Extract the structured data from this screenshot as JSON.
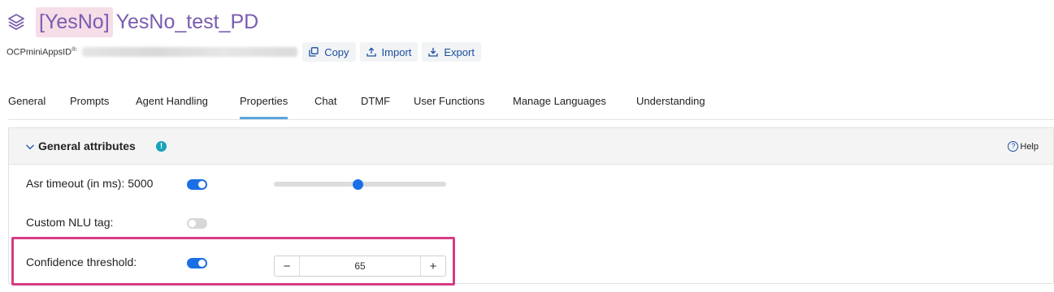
{
  "header": {
    "tag": "[YesNo]",
    "title": "YesNo_test_PD",
    "id_label": "OCPminiAppsID",
    "id_label_sup": "®:",
    "buttons": {
      "copy": "Copy",
      "import": "Import",
      "export": "Export"
    }
  },
  "icons": {
    "title": "layers-icon",
    "copy": "copy-icon",
    "import": "upload-icon",
    "export": "download-icon",
    "collapse": "chevron-down-icon",
    "info": "info-icon",
    "help": "question-circle-icon"
  },
  "tabs": [
    "General",
    "Prompts",
    "Agent Handling",
    "Properties",
    "Chat",
    "DTMF",
    "User Functions",
    "Manage Languages",
    "Understanding"
  ],
  "active_tab": "Properties",
  "panel": {
    "title": "General attributes",
    "info_glyph": "!",
    "help_glyph": "?",
    "help_label": "Help",
    "rows": {
      "asr": {
        "label": "Asr timeout (in ms): 5000",
        "enabled": true,
        "slider_fraction": 0.49
      },
      "nlu": {
        "label": "Custom NLU tag:",
        "enabled": false
      },
      "confidence": {
        "label": "Confidence threshold:",
        "enabled": true,
        "value": "65",
        "minus": "−",
        "plus": "+"
      }
    }
  },
  "colors": {
    "title": "#7a5cb0",
    "tag_bg": "#f6dde7",
    "accent": "#1a6fe6",
    "link": "#1b4fa0",
    "active_tab": "#5aa6e0",
    "highlight": "#d63c84",
    "info": "#17a2b8"
  }
}
